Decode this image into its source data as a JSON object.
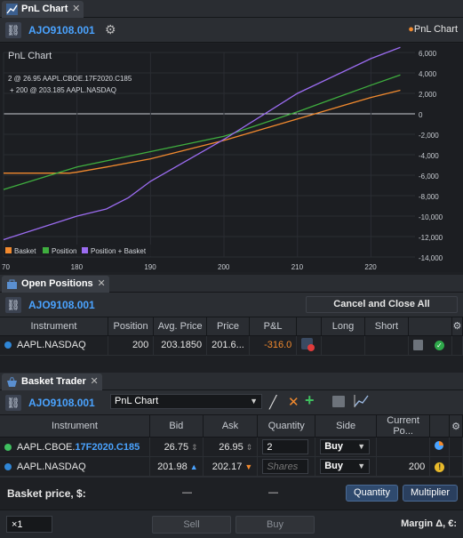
{
  "pnl_panel": {
    "tab_label": "PnL Chart",
    "account": "AJO9108.001",
    "right_label": "PnL Chart"
  },
  "chart_data": {
    "type": "line",
    "title": "PnL Chart",
    "annotations": [
      "2 @ 26.95 AAPL.CBOE.17F2020.C185",
      "+ 200 @ 203.185 AAPL.NASDAQ"
    ],
    "x_ticks": [
      "70",
      "180",
      "190",
      "200",
      "210",
      "220"
    ],
    "y_ticks": [
      "6,000",
      "4,000",
      "2,000",
      "0",
      "-2,000",
      "-4,000",
      "-6,000",
      "-8,000",
      "-10,000",
      "-12,000",
      "-14,000"
    ],
    "ylim": [
      -14000,
      6000
    ],
    "xlim": [
      170,
      226
    ],
    "grid": true,
    "legend_position": "bottom-left",
    "series": [
      {
        "name": "Basket",
        "color": "#f28a2e",
        "x": [
          170,
          179,
          180,
          184,
          190,
          200,
          210,
          220,
          224
        ],
        "y": [
          -5800,
          -5800,
          -5700,
          -5200,
          -4400,
          -2600,
          -500,
          1600,
          2300
        ]
      },
      {
        "name": "Position",
        "color": "#3fae3f",
        "x": [
          170,
          180,
          190,
          200,
          210,
          220,
          224
        ],
        "y": [
          -7400,
          -5200,
          -3700,
          -2200,
          200,
          2800,
          3800
        ]
      },
      {
        "name": "Position + Basket",
        "color": "#9b6cf0",
        "x": [
          170,
          180,
          184,
          187,
          190,
          200,
          210,
          220,
          224
        ],
        "y": [
          -12300,
          -10000,
          -9300,
          -8200,
          -6600,
          -2500,
          2000,
          5400,
          6500
        ]
      }
    ]
  },
  "open_positions": {
    "tab_label": "Open Positions",
    "account": "AJO9108.001",
    "cancel_button": "Cancel and Close All",
    "columns": [
      "Instrument",
      "Position",
      "Avg. Price",
      "Price",
      "P&L",
      "",
      "Long",
      "Short",
      ""
    ],
    "rows": [
      {
        "instrument": "AAPL.NASDAQ",
        "position": "200",
        "avg_price": "203.1850",
        "price": "201.6...",
        "pnl": "-316.0"
      }
    ]
  },
  "basket_trader": {
    "tab_label": "Basket Trader",
    "account": "AJO9108.001",
    "chart_select": "PnL Chart",
    "columns": [
      "Instrument",
      "Bid",
      "Ask",
      "Quantity",
      "Side",
      "Current Po..."
    ],
    "rows": [
      {
        "instrument_prefix": "AAPL.CBOE.",
        "instrument_highlight": "17F2020.C185",
        "bid": "26.75",
        "ask": "26.95",
        "quantity": "2",
        "side": "Buy",
        "current": "",
        "dot_color": "#3fbf5f"
      },
      {
        "instrument_prefix": "AAPL.NASDAQ",
        "instrument_highlight": "",
        "bid": "201.98",
        "ask": "202.17",
        "quantity_placeholder": "Shares",
        "side": "Buy",
        "current": "200",
        "dot_color": "#2f86d6"
      }
    ],
    "basket_price_label": "Basket price, $:",
    "basket_bid": "—",
    "basket_ask": "—",
    "quantity_button": "Quantity",
    "multiplier_button": "Multiplier",
    "multiplier_value": "×1",
    "sell_button": "Sell",
    "buy_button": "Buy",
    "margin_label": "Margin Δ, €:"
  }
}
